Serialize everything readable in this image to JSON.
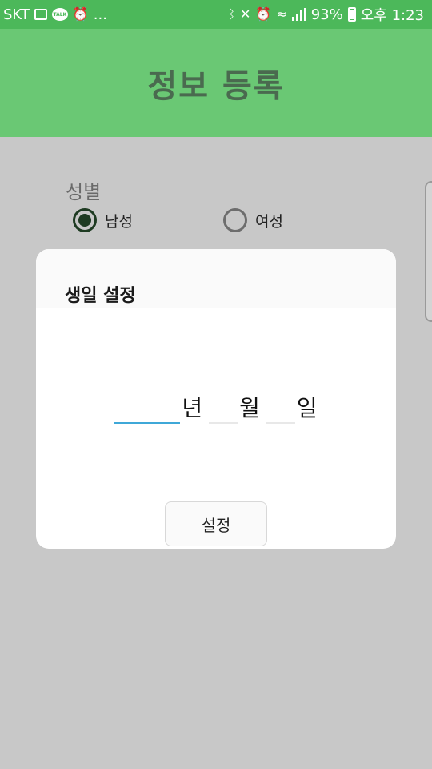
{
  "status_bar": {
    "carrier": "SKT",
    "more": "...",
    "battery_percent": "93%",
    "time": "오후 1:23",
    "icons": [
      "image-icon",
      "kakaotalk-icon",
      "alarm-icon",
      "bluetooth-icon",
      "mute-icon",
      "alarm-icon",
      "wifi-icon",
      "signal-icon",
      "battery-icon"
    ]
  },
  "app_bar": {
    "title": "정보 등록"
  },
  "form": {
    "gender_label": "성별",
    "gender_options": [
      {
        "label": "남성",
        "checked": true
      },
      {
        "label": "여성",
        "checked": false
      }
    ]
  },
  "dialog": {
    "title": "생일 설정",
    "year_value": "",
    "month_value": "",
    "day_value": "",
    "year_unit": "년",
    "month_unit": "월",
    "day_unit": "일",
    "set_button_label": "설정"
  },
  "colors": {
    "status_bar": "#4cb85a",
    "app_bar": "#6ac874",
    "title_text": "#4a6a4f",
    "background": "#c8c8c8",
    "input_focus_underline": "#3fa8d8"
  }
}
